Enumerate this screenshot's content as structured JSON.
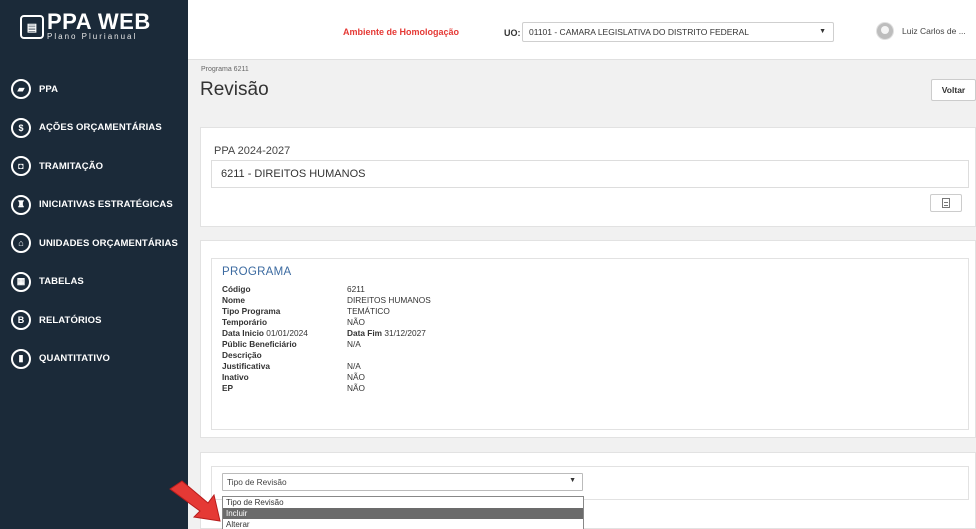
{
  "app": {
    "logo_title": "PPA WEB",
    "logo_subtitle": "Plano Plurianual"
  },
  "sidebar": {
    "items": [
      {
        "label": "PPA",
        "icon": "book-icon"
      },
      {
        "label": "AÇÕES ORÇAMENTÁRIAS",
        "icon": "dollar-icon"
      },
      {
        "label": "TRAMITAÇÃO",
        "icon": "inbox-icon"
      },
      {
        "label": "INICIATIVAS ESTRATÉGICAS",
        "icon": "building-icon"
      },
      {
        "label": "UNIDADES ORÇAMENTÁRIAS",
        "icon": "bank-icon"
      },
      {
        "label": "TABELAS",
        "icon": "table-icon"
      },
      {
        "label": "RELATÓRIOS",
        "icon": "report-icon"
      },
      {
        "label": "QUANTITATIVO",
        "icon": "bar-chart-icon"
      }
    ]
  },
  "header": {
    "environment": "Ambiente de Homologação",
    "uo_label": "UO:",
    "uo_value": "01101 - CAMARA LEGISLATIVA DO DISTRITO FEDERAL",
    "user_name": "Luiz Carlos de ..."
  },
  "page": {
    "breadcrumb": "Programa 6211",
    "title": "Revisão",
    "back_label": "Voltar"
  },
  "ppa": {
    "period": "PPA 2024-2027",
    "program_name": "6211 - DIREITOS HUMANOS"
  },
  "programa": {
    "section_title": "PROGRAMA",
    "fields": [
      {
        "label": "Código",
        "value": "6211"
      },
      {
        "label": "Nome",
        "value": "DIREITOS HUMANOS"
      },
      {
        "label": "Tipo Programa",
        "value": "TEMÁTICO"
      },
      {
        "label": "Temporário",
        "value": "NÃO"
      },
      {
        "label": "Data Inicio",
        "value": ""
      },
      {
        "label": "Públic Beneficiário",
        "value": "N/A"
      },
      {
        "label": "Descrição",
        "value": ""
      },
      {
        "label": "Justificativa",
        "value": "N/A"
      },
      {
        "label": "Inativo",
        "value": "NÃO"
      },
      {
        "label": "EP",
        "value": "NÃO"
      }
    ],
    "data_inicio_value": "01/01/2024",
    "data_fim_label": "Data Fim",
    "data_fim_value": "31/12/2027"
  },
  "revisao": {
    "select_value": "Tipo de Revisão",
    "options": [
      "Tipo de Revisão",
      "Incluir",
      "Alterar"
    ],
    "highlighted_option": "Incluir"
  },
  "colors": {
    "sidebar_bg": "#1b2a39",
    "environment_text": "#e53935",
    "programa_title": "#3b6aa0",
    "arrow": "#e53935"
  }
}
